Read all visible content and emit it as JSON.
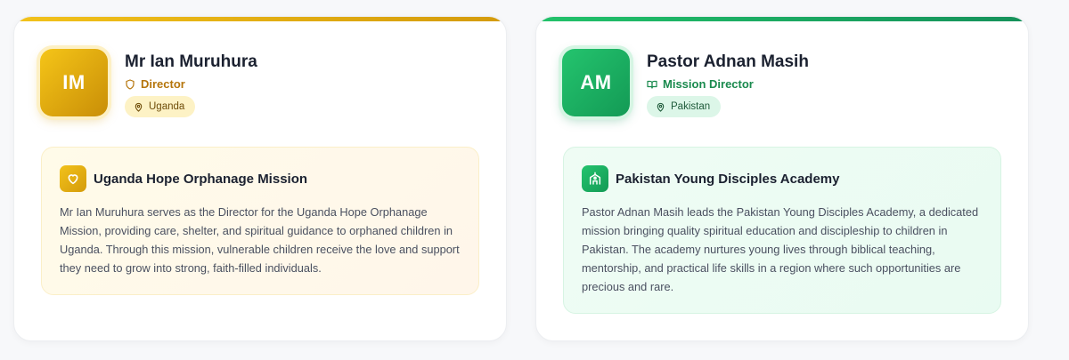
{
  "cards": [
    {
      "initials": "IM",
      "name": "Mr Ian Muruhura",
      "role": "Director",
      "role_icon": "shield-icon",
      "location": "Uganda",
      "mission_icon": "heart-icon",
      "mission_title": "Uganda Hope Orphanage Mission",
      "mission_text": "Mr Ian Muruhura serves as the Director for the Uganda Hope Orphanage Mission, providing care, shelter, and spiritual guidance to orphaned children in Uganda. Through this mission, vulnerable children receive the love and support they need to grow into strong, faith-filled individuals.",
      "accent": "#d49b0b"
    },
    {
      "initials": "AM",
      "name": "Pastor Adnan Masih",
      "role": "Mission Director",
      "role_icon": "book-open-icon",
      "location": "Pakistan",
      "mission_icon": "school-icon",
      "mission_title": "Pakistan Young Disciples Academy",
      "mission_text": "Pastor Adnan Masih leads the Pakistan Young Disciples Academy, a dedicated mission bringing quality spiritual education and discipleship to children in Pakistan. The academy nurtures young lives through biblical teaching, mentorship, and practical life skills in a region where such opportunities are precious and rare.",
      "accent": "#15915a"
    }
  ]
}
